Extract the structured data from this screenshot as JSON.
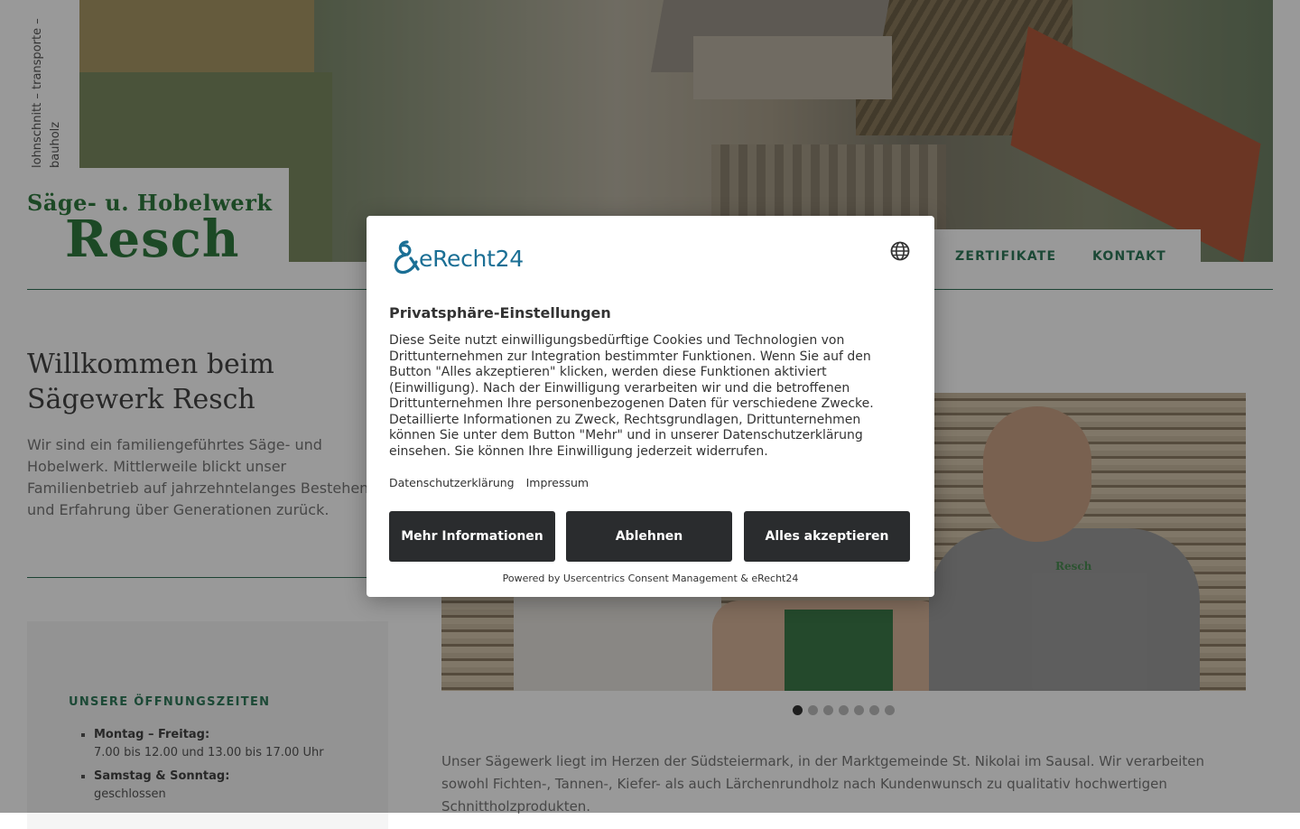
{
  "site": {
    "tagline": "lohnschnitt – transporte – bauholz",
    "brand_line1": "Säge- u. Hobelwerk",
    "brand_line2": "Resch",
    "nav": [
      "ZERTIFIKATE",
      "KONTAKT"
    ],
    "welcome_title": "Willkommen beim Sägewerk Resch",
    "intro": "Wir sind ein familiengeführtes Säge- und Hobelwerk. Mittlerweile blickt unser Familienbetrieb auf jahrzehntelanges Bestehen und Erfahrung über Generationen zurück.",
    "hours": {
      "title": "UNSERE ÖFFNUNGSZEITEN",
      "items": [
        {
          "day": "Montag – Freitag:",
          "time": "7.00 bis 12.00 und 13.00 bis 17.00 Uhr"
        },
        {
          "day": "Samstag & Sonntag:",
          "time": "geschlossen"
        }
      ]
    },
    "photo_shirt_logo": "Resch",
    "slider_dots": 7,
    "slider_active": 1,
    "about_text": "Unser Sägewerk liegt im Herzen der Südsteiermark, in der Marktgemeinde St. Nikolai im Sausal. Wir verarbeiten sowohl Fichten-, Tannen-, Kiefer- als auch Lärchenrundholz nach Kundenwunsch zu qualitativ hochwertigen Schnittholzprodukten."
  },
  "consent": {
    "logo_text": "eRecht24",
    "language_icon": "globe-icon",
    "title": "Privatsphäre-Einstellungen",
    "description": "Diese Seite nutzt einwilligungsbedürftige Cookies und Technologien von Drittunternehmen zur Integration bestimmter Funktionen. Wenn Sie auf den Button \"Alles akzeptieren\" klicken, werden diese Funktionen aktiviert (Einwilligung). Nach der Einwilligung verarbeiten wir und die betroffenen Drittunternehmen Ihre personenbezogenen Daten für verschiedene Zwecke. Detaillierte Informationen zu Zweck, Rechtsgrundlagen, Drittunternehmen können Sie unter dem Button \"Mehr\" und in unserer Datenschutzerklärung einsehen. Sie können Ihre Einwilligung jederzeit widerrufen.",
    "links": [
      "Datenschutzerklärung",
      "Impressum"
    ],
    "buttons": {
      "more": "Mehr Informationen",
      "deny": "Ablehnen",
      "accept": "Alles akzeptieren"
    },
    "powered_by": "Powered by Usercentrics Consent Management & eRecht24",
    "colors": {
      "button_bg": "#2a2c2e",
      "logo_blue": "#1b6f95",
      "brand_green": "#2f7a3f"
    }
  }
}
